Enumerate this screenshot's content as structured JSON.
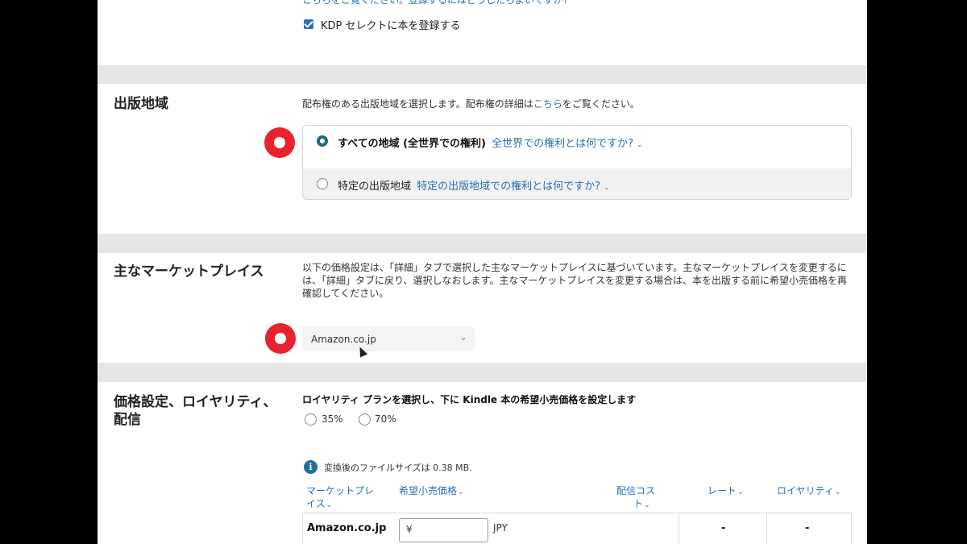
{
  "top_section": {
    "cut_link_text": "こちらをご覧ください。登録するにはどうしたらよいですか?",
    "kdp_select_label": "KDP セレクトに本を登録する",
    "kdp_select_checked": true
  },
  "territories": {
    "title": "出版地域",
    "description_prefix": "配布権のある出版地域を選択します。配布権の詳細は",
    "description_link": "こちら",
    "description_suffix": "をご覧ください。",
    "option_all_label": "すべての地域 (全世界での権利)",
    "option_all_link": "全世界での権利とは何ですか?",
    "option_specific_label": "特定の出版地域",
    "option_specific_link": "特定の出版地域での権利とは何ですか?",
    "selected": "all"
  },
  "marketplace": {
    "title": "主なマーケットプレイス",
    "description": "以下の価格設定は、「詳細」タブで選択した主なマーケットプレイスに基づいています。主なマーケットプレイスを変更するには、「詳細」タブに戻り、選択しなおします。主なマーケットプレイスを変更する場合は、本を出版する前に希望小売価格を再確認してください。",
    "selected_value": "Amazon.co.jp"
  },
  "pricing": {
    "title_line1": "価格設定、ロイヤリティ、",
    "title_line2": "配信",
    "royalty_heading": "ロイヤリティ プランを選択し、下に Kindle 本の希望小売価格を設定します",
    "option_35": "35%",
    "option_70": "70%",
    "file_size_note": "変換後のファイルサイズは 0.38 MB.",
    "columns": {
      "marketplace_line1": "マーケットプレ",
      "marketplace_line2": "イス",
      "list_price": "希望小売価格",
      "delivery_line1": "配信コス",
      "delivery_line2": "ト",
      "rate": "レート",
      "royalty": "ロイヤリティ"
    },
    "row": {
      "marketplace": "Amazon.co.jp",
      "currency_prefix": "¥",
      "currency": "JPY",
      "rate": "-",
      "royalty": "-"
    }
  },
  "colors": {
    "link": "#2b6fb0",
    "annotation_red": "#e8232e",
    "radio_selected": "#1d6f73",
    "band_gray": "#e6e6e6"
  }
}
